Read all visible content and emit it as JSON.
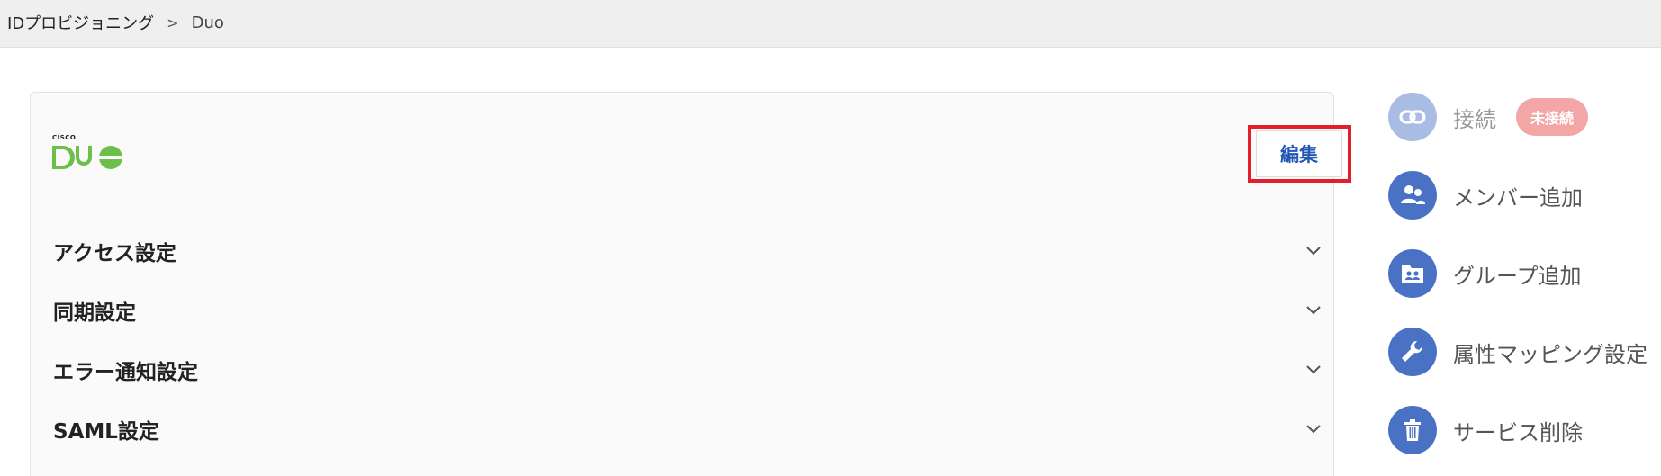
{
  "breadcrumb": {
    "parent": "IDプロビジョニング",
    "separator": ">",
    "current": "Duo"
  },
  "card": {
    "logo": {
      "top_text": "CISCO",
      "name": "Duo"
    },
    "edit_label": "編集",
    "sections": [
      {
        "label": "アクセス設定"
      },
      {
        "label": "同期設定"
      },
      {
        "label": "エラー通知設定"
      },
      {
        "label": "SAML設定"
      }
    ]
  },
  "sidebar": {
    "items": [
      {
        "label": "接続",
        "icon": "link-icon",
        "badge": "未接続",
        "disabled": true
      },
      {
        "label": "メンバー追加",
        "icon": "users-icon"
      },
      {
        "label": "グループ追加",
        "icon": "group-folder-icon"
      },
      {
        "label": "属性マッピング設定",
        "icon": "wrench-icon"
      },
      {
        "label": "サービス削除",
        "icon": "trash-icon"
      }
    ]
  },
  "colors": {
    "accent": "#4a72c4",
    "accent_disabled": "#a9bde4",
    "edit_text": "#2456b5",
    "highlight": "#e0202a",
    "badge": "#f2a6a6",
    "duo_green": "#6dbf4b"
  }
}
